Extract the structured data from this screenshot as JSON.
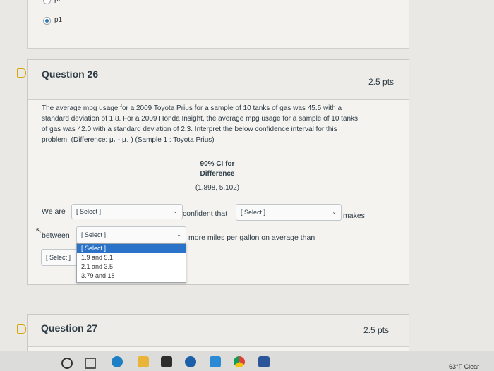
{
  "prev_question": {
    "option_above": "p2",
    "option_selected": "p1"
  },
  "q26": {
    "title": "Question 26",
    "points": "2.5 pts",
    "body_lines": [
      "The average mpg usage for a 2009 Toyota Prius for a sample of 10 tanks of gas was 45.5 with a",
      "standard deviation of 1.8. For a 2009 Honda Insight, the average mpg usage for a sample of 10 tanks",
      "of gas was 42.0 with a standard deviation of 2.3. Interpret the below confidence interval for this",
      "problem: (Difference: μ₁ - μ₂ ) (Sample 1 : Toyota Prius)"
    ],
    "ci_heading_line1": "90% CI for",
    "ci_heading_line2": "Difference",
    "ci_value": "(1.898, 5.102)",
    "we_are": "We are",
    "confident_that": "confident that",
    "makes": "makes",
    "between": "between",
    "more_miles": "more miles per gallon on average than",
    "select_placeholder": "[ Select ]",
    "dropdown_options": [
      "[ Select ]",
      "1.9 and 5.1",
      "2.1 and 3.5",
      "3.79 and 18"
    ]
  },
  "q27": {
    "title": "Question 27",
    "points": "2.5 pts"
  },
  "taskbar": {
    "weather": "63°F Clear"
  },
  "colors": {
    "flag": "#d9a600",
    "dropdown_highlight": "#2a73c9"
  }
}
